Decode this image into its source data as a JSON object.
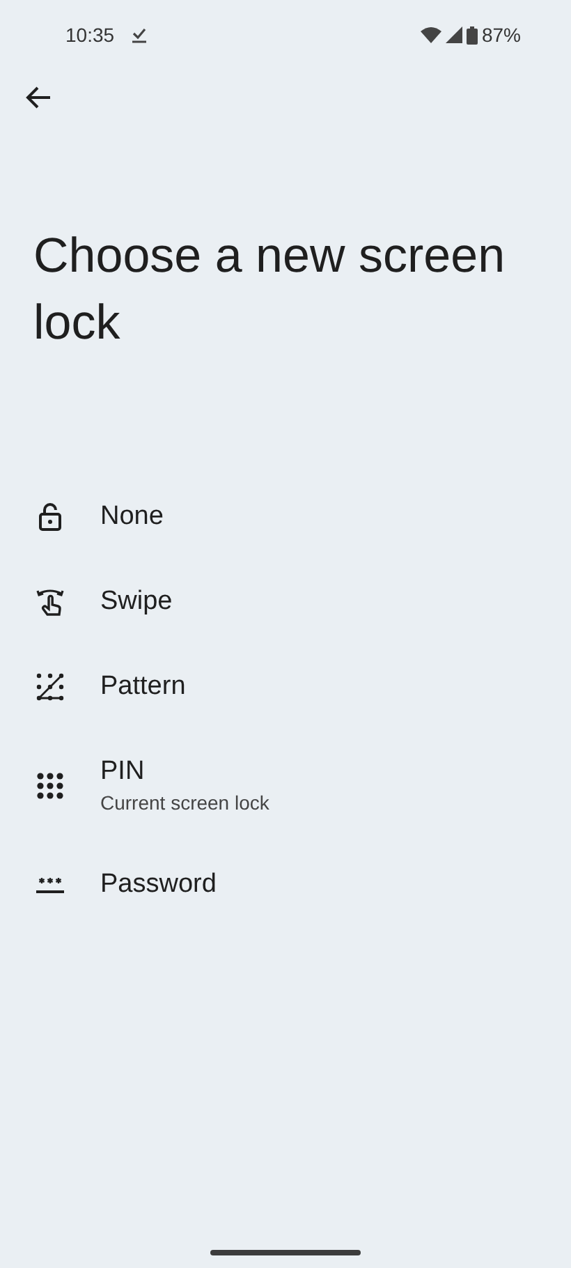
{
  "status_bar": {
    "time": "10:35",
    "battery": "87%"
  },
  "title": "Choose a new screen lock",
  "options": [
    {
      "kind": "none",
      "label": "None"
    },
    {
      "kind": "swipe",
      "label": "Swipe"
    },
    {
      "kind": "pattern",
      "label": "Pattern"
    },
    {
      "kind": "pin",
      "label": "PIN",
      "summary": "Current screen lock"
    },
    {
      "kind": "password",
      "label": "Password"
    }
  ]
}
